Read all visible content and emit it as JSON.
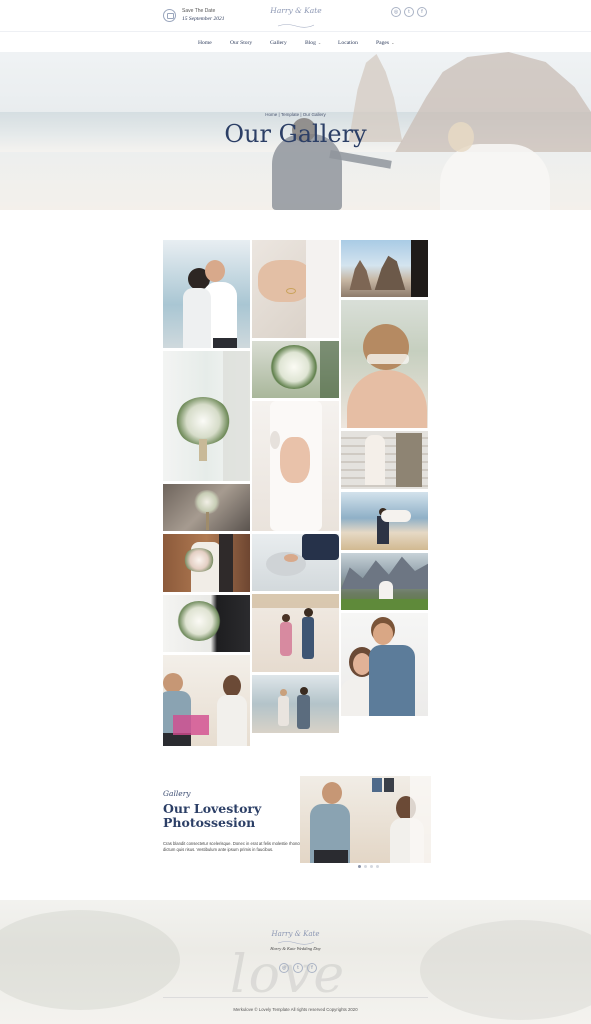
{
  "header": {
    "save_the_date": "Save The Date",
    "date": "15 September 2021",
    "logo": "Harry & Kate",
    "social": [
      {
        "icon": "instagram-icon",
        "glyph": "◎"
      },
      {
        "icon": "twitter-icon",
        "glyph": "t"
      },
      {
        "icon": "facebook-icon",
        "glyph": "f"
      }
    ]
  },
  "nav": {
    "items": [
      "Home",
      "Our Story",
      "Gallery",
      "Blog",
      "Location",
      "Pages"
    ]
  },
  "hero": {
    "breadcrumb": "Home | Template | Our Gallery",
    "title": "Our Gallery"
  },
  "lovestory": {
    "subtitle": "Gallery",
    "title_line1": "Our Lovestory",
    "title_line2": "Photossesion",
    "body": "Cras blandit consectetur scelerisque. Donec in erat at felis molestie rhoncus dictum quis risus. Vestibulum ante ipsum primis in faucibus."
  },
  "footer": {
    "logo": "Harry & Kate",
    "tagline": "Harry & Kate Wedding Day",
    "watermark": "love",
    "copyright": "Merkulove © Lovely Template All rights reserved Copyrights 2020"
  },
  "colors": {
    "navy": "#2c3f66",
    "accent": "#8c97b3"
  }
}
